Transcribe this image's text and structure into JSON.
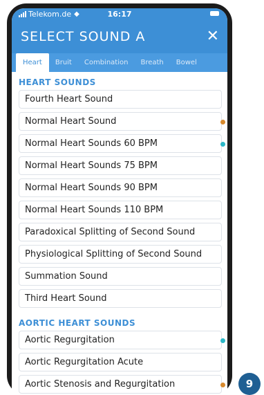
{
  "status": {
    "carrier": "Telekom.de",
    "time": "16:17"
  },
  "header": {
    "title": "SELECT SOUND A",
    "close_symbol": "✕"
  },
  "tabs": [
    "Heart",
    "Bruit",
    "Combination",
    "Breath",
    "Bowel"
  ],
  "sections": [
    {
      "title": "HEART SOUNDS",
      "items": [
        {
          "label": "Fourth Heart Sound",
          "dot": ""
        },
        {
          "label": "Normal Heart Sound",
          "dot": "orange"
        },
        {
          "label": "Normal Heart Sounds 60 BPM",
          "dot": "teal"
        },
        {
          "label": "Normal Heart Sounds 75 BPM",
          "dot": ""
        },
        {
          "label": "Normal Heart Sounds 90 BPM",
          "dot": ""
        },
        {
          "label": "Normal Heart Sounds 110 BPM",
          "dot": ""
        },
        {
          "label": "Paradoxical Splitting of Second Sound",
          "dot": ""
        },
        {
          "label": "Physiological Splitting of Second Sound",
          "dot": ""
        },
        {
          "label": "Summation Sound",
          "dot": ""
        },
        {
          "label": "Third Heart Sound",
          "dot": ""
        }
      ]
    },
    {
      "title": "AORTIC HEART SOUNDS",
      "items": [
        {
          "label": "Aortic Regurgitation",
          "dot": "teal"
        },
        {
          "label": "Aortic Regurgitation Acute",
          "dot": ""
        },
        {
          "label": "Aortic Stenosis and Regurgitation",
          "dot": "orange"
        }
      ]
    }
  ],
  "colors": {
    "accent": "#3d8fd6",
    "dot_orange": "#d88a2d",
    "dot_teal": "#2bb8c8"
  },
  "page_badge": "9"
}
